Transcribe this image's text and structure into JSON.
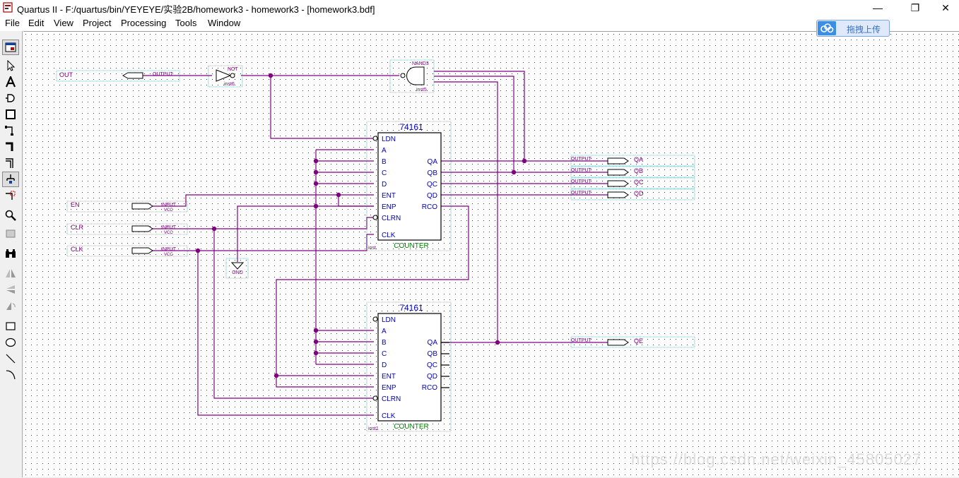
{
  "window": {
    "title": "Quartus II - F:/quartus/bin/YEYEYE/实验2B/homework3 - homework3 - [homework3.bdf]",
    "minimize_glyph": "—",
    "maximize_glyph": "❐",
    "close_glyph": "✕"
  },
  "menu": [
    "File",
    "Edit",
    "View",
    "Project",
    "Processing",
    "Tools",
    "Window"
  ],
  "upload_button": {
    "label": "拖拽上传"
  },
  "toolbar_icons": [
    "window-icon",
    "pointer-icon",
    "text-icon",
    "symbol-icon",
    "block-icon",
    "orthogonal-node-icon",
    "orthogonal-bus-icon",
    "orthogonal-conduit-icon",
    "rubberbanding-icon",
    "partial-line-select-icon",
    "zoom-icon",
    "fullscreen-icon",
    "find-icon",
    "flip-horizontal-icon",
    "flip-vertical-icon",
    "rotate-icon",
    "rectangle-icon",
    "oval-icon",
    "line-icon",
    "arc-icon"
  ],
  "watermark": "https://blog.csdn.net/weixin_45805027",
  "schematic": {
    "out_pin": {
      "name": "OUT",
      "kind": "OUTPUT"
    },
    "not_gate": {
      "type": "NOT",
      "inst": "inst6"
    },
    "nand_gate": {
      "type": "NAND3",
      "inst": "inst5"
    },
    "counter1": {
      "part": "74161",
      "func": "COUNTER",
      "inst": "inst",
      "inputs": [
        "LDN",
        "A",
        "B",
        "C",
        "D",
        "ENT",
        "ENP",
        "CLRN",
        "CLK"
      ],
      "outputs": [
        "QA",
        "QB",
        "QC",
        "QD",
        "RCO"
      ]
    },
    "counter2": {
      "part": "74161",
      "func": "COUNTER",
      "inst": "inst1",
      "inputs": [
        "LDN",
        "A",
        "B",
        "C",
        "D",
        "ENT",
        "ENP",
        "CLRN",
        "CLK"
      ],
      "outputs": [
        "QA",
        "QB",
        "QC",
        "QD",
        "RCO"
      ]
    },
    "input_pins": [
      {
        "name": "EN",
        "kind": "INPUT",
        "default": "VCC"
      },
      {
        "name": "CLR",
        "kind": "INPUT",
        "default": "VCC"
      },
      {
        "name": "CLK",
        "kind": "INPUT",
        "default": "VCC"
      }
    ],
    "gnd": "GND",
    "output_pins": [
      {
        "name": "QA",
        "kind": "OUTPUT"
      },
      {
        "name": "QB",
        "kind": "OUTPUT"
      },
      {
        "name": "QC",
        "kind": "OUTPUT"
      },
      {
        "name": "QD",
        "kind": "OUTPUT"
      },
      {
        "name": "QE",
        "kind": "OUTPUT"
      }
    ],
    "colors": {
      "wire": "#800080",
      "pin_text": "#0000c0",
      "func_text": "#008000",
      "inst_text": "#800080",
      "dot_grid": "#303030"
    }
  }
}
